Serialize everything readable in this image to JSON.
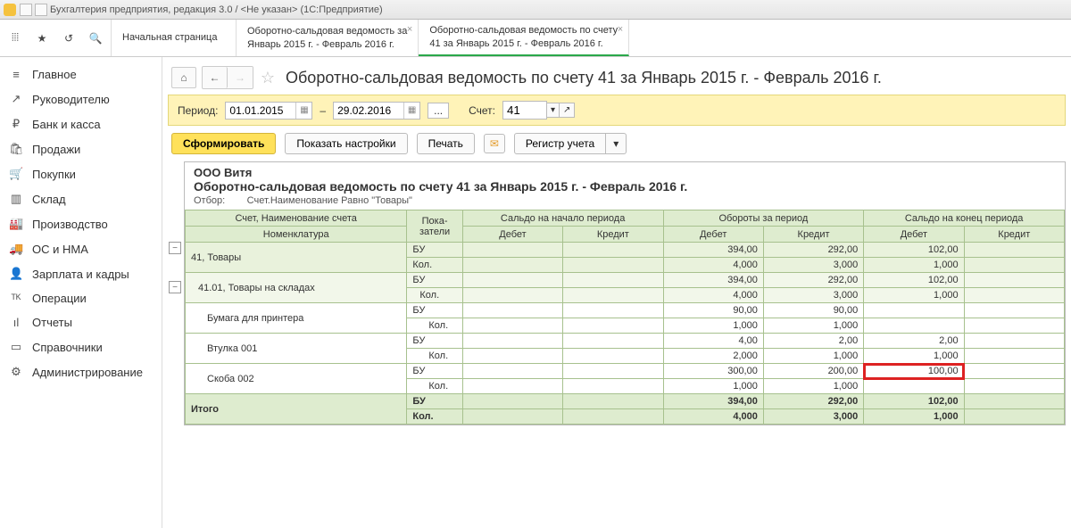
{
  "window": {
    "title": "Бухгалтерия предприятия, редакция 3.0 / <Не указан> (1С:Предприятие)"
  },
  "tabs": {
    "home": "Начальная страница",
    "t1a": "Оборотно-сальдовая ведомость за",
    "t1b": "Январь 2015 г. - Февраль 2016 г.",
    "t2a": "Оборотно-сальдовая ведомость по счету",
    "t2b": "41 за Январь 2015 г. - Февраль 2016 г."
  },
  "sidebar": {
    "items": [
      {
        "icon": "≡",
        "label": "Главное"
      },
      {
        "icon": "↗",
        "label": "Руководителю"
      },
      {
        "icon": "₽",
        "label": "Банк и касса"
      },
      {
        "icon": "🛍",
        "label": "Продажи"
      },
      {
        "icon": "🛒",
        "label": "Покупки"
      },
      {
        "icon": "▥",
        "label": "Склад"
      },
      {
        "icon": "🏭",
        "label": "Производство"
      },
      {
        "icon": "🚚",
        "label": "ОС и НМА"
      },
      {
        "icon": "👤",
        "label": "Зарплата и кадры"
      },
      {
        "icon": "ᵀᴷ",
        "label": "Операции"
      },
      {
        "icon": "ıl",
        "label": "Отчеты"
      },
      {
        "icon": "▭",
        "label": "Справочники"
      },
      {
        "icon": "⚙",
        "label": "Администрирование"
      }
    ]
  },
  "page": {
    "title": "Оборотно-сальдовая ведомость по счету 41 за Январь 2015 г. - Февраль 2016 г."
  },
  "period": {
    "label": "Период:",
    "from": "01.01.2015",
    "to": "29.02.2016",
    "dash": "–",
    "acct_label": "Счет:",
    "acct": "41"
  },
  "toolbar": {
    "form": "Сформировать",
    "settings": "Показать настройки",
    "print": "Печать",
    "reg": "Регистр учета"
  },
  "report": {
    "org": "ООО Витя",
    "title": "Оборотно-сальдовая ведомость по счету 41 за Январь 2015 г. - Февраль 2016 г.",
    "filter_lbl": "Отбор:",
    "filter_val": "Счет.Наименование Равно \"Товары\"",
    "headers": {
      "acct": "Счет, Наименование счета",
      "nom": "Номенклатура",
      "pok": "Пока-\nзатели",
      "start": "Сальдо на начало периода",
      "turn": "Обороты за период",
      "end": "Сальдо на конец периода",
      "debit": "Дебет",
      "credit": "Кредит"
    },
    "rows": [
      {
        "lvl": 0,
        "name": "41, Товары",
        "p": "БУ",
        "sd": "",
        "sc": "",
        "td": "394,00",
        "tc": "292,00",
        "ed": "102,00",
        "ec": ""
      },
      {
        "lvl": 0,
        "name": "",
        "p": "Кол.",
        "sd": "",
        "sc": "",
        "td": "4,000",
        "tc": "3,000",
        "ed": "1,000",
        "ec": ""
      },
      {
        "lvl": 1,
        "name": "41.01, Товары на складах",
        "p": "БУ",
        "sd": "",
        "sc": "",
        "td": "394,00",
        "tc": "292,00",
        "ed": "102,00",
        "ec": ""
      },
      {
        "lvl": 1,
        "name": "",
        "p": "Кол.",
        "sd": "",
        "sc": "",
        "td": "4,000",
        "tc": "3,000",
        "ed": "1,000",
        "ec": ""
      },
      {
        "lvl": 2,
        "name": "Бумага для принтера",
        "p": "БУ",
        "sd": "",
        "sc": "",
        "td": "90,00",
        "tc": "90,00",
        "ed": "",
        "ec": ""
      },
      {
        "lvl": 2,
        "name": "",
        "p": "Кол.",
        "sd": "",
        "sc": "",
        "td": "1,000",
        "tc": "1,000",
        "ed": "",
        "ec": ""
      },
      {
        "lvl": 2,
        "name": "Втулка 001",
        "p": "БУ",
        "sd": "",
        "sc": "",
        "td": "4,00",
        "tc": "2,00",
        "ed": "2,00",
        "ec": ""
      },
      {
        "lvl": 2,
        "name": "",
        "p": "Кол.",
        "sd": "",
        "sc": "",
        "td": "2,000",
        "tc": "1,000",
        "ed": "1,000",
        "ec": ""
      },
      {
        "lvl": 2,
        "name": "Скоба 002",
        "p": "БУ",
        "sd": "",
        "sc": "",
        "td": "300,00",
        "tc": "200,00",
        "ed": "100,00",
        "ec": "",
        "hl": true
      },
      {
        "lvl": 2,
        "name": "",
        "p": "Кол.",
        "sd": "",
        "sc": "",
        "td": "1,000",
        "tc": "1,000",
        "ed": "",
        "ec": ""
      }
    ],
    "total": {
      "label": "Итого",
      "r1": {
        "p": "БУ",
        "td": "394,00",
        "tc": "292,00",
        "ed": "102,00"
      },
      "r2": {
        "p": "Кол.",
        "td": "4,000",
        "tc": "3,000",
        "ed": "1,000"
      }
    }
  }
}
